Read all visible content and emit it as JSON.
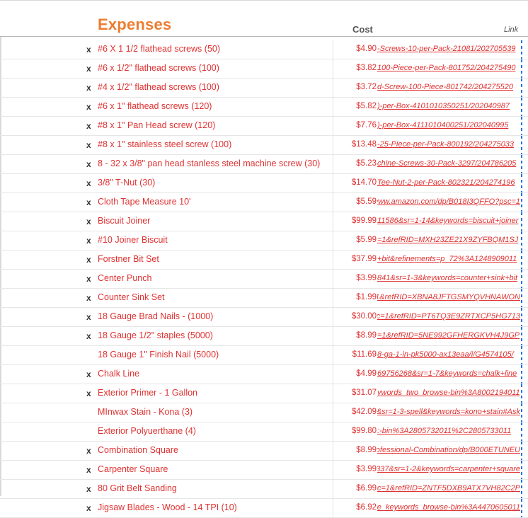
{
  "header": {
    "title": "Expenses",
    "cost_col": "Cost",
    "link_col": "Link"
  },
  "rows": [
    {
      "check": "x",
      "item": "#6 X 1 1/2 flathead screws (50)",
      "cost": "$4.90",
      "link": "-Screws-10-per-Pack-21081/202705539"
    },
    {
      "check": "x",
      "item": "#6 x 1/2\" flathead screws (100)",
      "cost": "$3.82",
      "link": "100-Piece-per-Pack-801752/204275490"
    },
    {
      "check": "x",
      "item": "#4 x 1/2\" flathead screws (100)",
      "cost": "$3.72",
      "link": "d-Screw-100-Piece-801742/204275520"
    },
    {
      "check": "x",
      "item": "#6 x 1\" flathead screws (120)",
      "cost": "$5.82",
      "link": ")-per-Box-4101010350251/202040987"
    },
    {
      "check": "x",
      "item": "#8 x 1\" Pan Head screw (120)",
      "cost": "$7.76",
      "link": ")-per-Box-4111010400251/202040995"
    },
    {
      "check": "x",
      "item": "#8 x 1\" stainless steel screw (100)",
      "cost": "$13.48",
      "link": "-25-Piece-per-Pack-800192/204275033"
    },
    {
      "check": "x",
      "item": "8 - 32 x 3/8\" pan head stanless steel machine screw (30)",
      "cost": "$5.23",
      "link": "chine-Screws-30-Pack-3297/204786205"
    },
    {
      "check": "x",
      "item": "3/8\" T-Nut (30)",
      "cost": "$14.70",
      "link": "Tee-Nut-2-per-Pack-802321/204274196"
    },
    {
      "check": "x",
      "item": "Cloth Tape Measure 10'",
      "cost": "$5.59",
      "link": "www.amazon.com/dp/B018I3QFFO?psc=1"
    },
    {
      "check": "x",
      "item": "Biscuit Joiner",
      "cost": "$99.99",
      "link": "11586&sr=1-14&keywords=biscuit+joiner"
    },
    {
      "check": "x",
      "item": "#10 Joiner Biscuit",
      "cost": "$5.99",
      "link": "=1&refRID=MXH23ZE21X9ZYFBQM1SJ"
    },
    {
      "check": "x",
      "item": "Forstner Bit Set",
      "cost": "$37.99",
      "link": "+bit&refinements=p_72%3A1248909011"
    },
    {
      "check": "x",
      "item": "Center Punch",
      "cost": "$3.99",
      "link": "841&sr=1-3&keywords=counter+sink+bit"
    },
    {
      "check": "x",
      "item": "Counter Sink Set",
      "cost": "$1.99",
      "link": ":1&refRID=XBNA8JFTGSMYQVHNAWON"
    },
    {
      "check": "x",
      "item": "18 Gauge Brad Nails - (1000)",
      "cost": "$30.00",
      "link": "c=1&refRID=PT6TQ3E9ZRTXCP5HG713"
    },
    {
      "check": "x",
      "item": "18 Gauge 1/2\" staples (5000)",
      "cost": "$8.99",
      "link": "=1&refRID=5NE992GFHERGKVH4J9GP"
    },
    {
      "check": "",
      "item": "18 Gauge 1\" Finish Nail (5000)",
      "cost": "$11.69",
      "link": "8-ga-1-in-pk5000-ax13eaa/i/G4574105/"
    },
    {
      "check": "x",
      "item": "Chalk Line",
      "cost": "$4.99",
      "link": "69756268&sr=1-7&keywords=chalk+line"
    },
    {
      "check": "x",
      "item": "Exterior Primer - 1 Gallon",
      "cost": "$31.07",
      "link": "ywords_two_browse-bin%3A8002194011"
    },
    {
      "check": "",
      "item": "MInwax Stain - Kona (3)",
      "cost": "$42.09",
      "link": "&sr=1-3-spell&keywords=kono+stain#Ask"
    },
    {
      "check": "",
      "item": "Exterior Polyuerthane (4)",
      "cost": "$99.80",
      "link": ":-bin%3A2805732011%2C2805733011"
    },
    {
      "check": "x",
      "item": "Combination Square",
      "cost": "$8.99",
      "link": "ofessional-Combination/dp/B000ETUNEU"
    },
    {
      "check": "x",
      "item": "Carpenter Square",
      "cost": "$3.99",
      "link": "337&sr=1-2&keywords=carpenter+square"
    },
    {
      "check": "x",
      "item": "80 Grit Belt Sanding",
      "cost": "$6.99",
      "link": "c=1&refRID=ZNTF5DXB9ATX7VH82C2P"
    },
    {
      "check": "x",
      "item": "Jigsaw Blades - Wood - 14 TPI (10)",
      "cost": "$6.92",
      "link": "e_keywords_browse-bin%3A4470605011"
    }
  ],
  "colors": {
    "title": "#ed7d31",
    "item_text": "#e03131",
    "selection_dash": "#1a73e8"
  }
}
